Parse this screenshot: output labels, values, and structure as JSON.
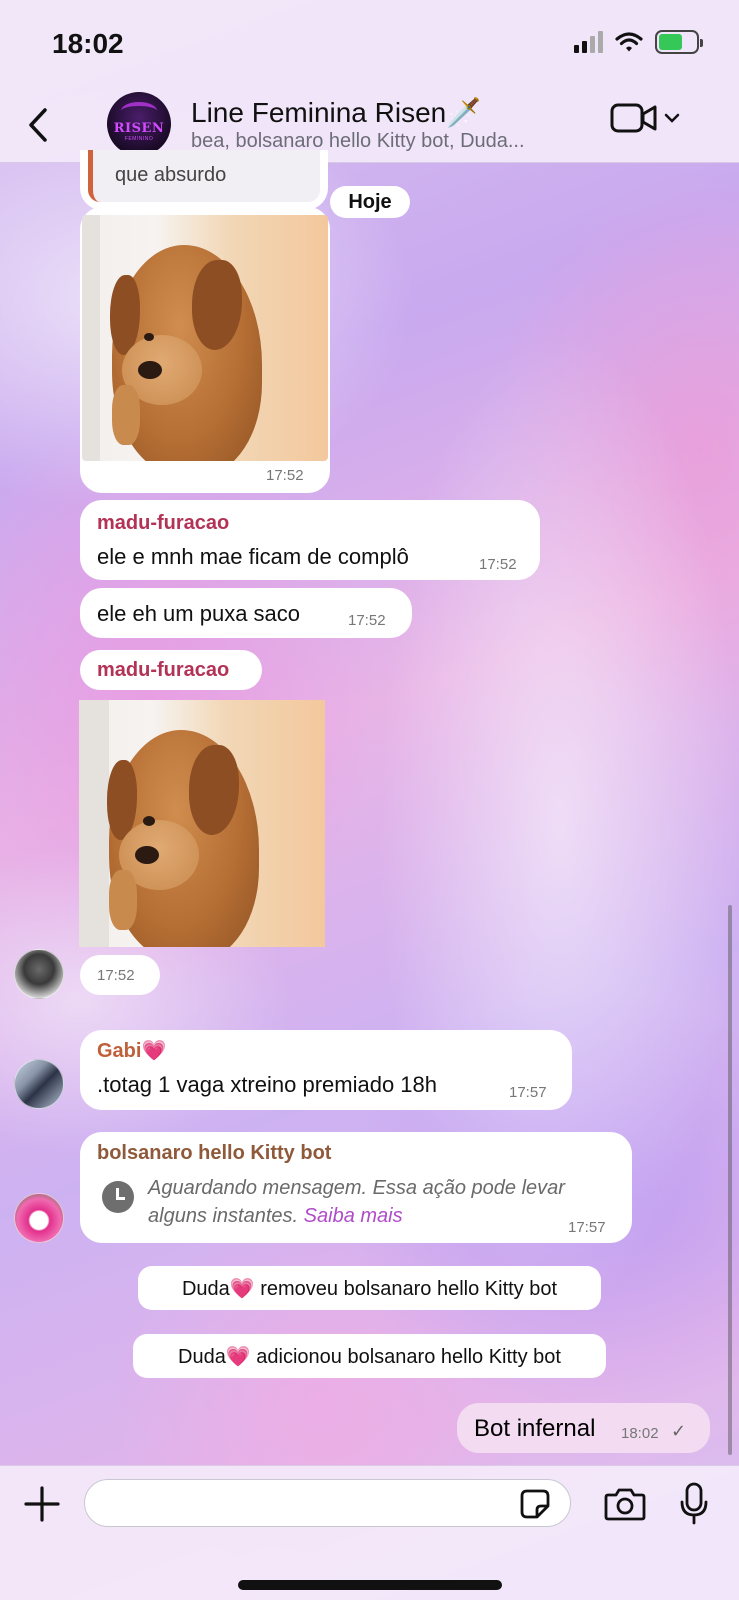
{
  "status_bar": {
    "time": "18:02"
  },
  "header": {
    "title": "Line Feminina Risen🗡️",
    "subtitle": "bea, bolsanaro hello Kitty bot, Duda...",
    "group_avatar_text": "RISEN",
    "group_avatar_subtext": "FEMININO"
  },
  "chat": {
    "quoted_text": "que absurdo",
    "date_pill": "Hoje",
    "image_msg_1_time": "17:52",
    "msg_1": {
      "sender": "madu-furacao",
      "text": "ele e mnh mae ficam de complô",
      "time": "17:52"
    },
    "msg_2": {
      "text": "ele eh um puxa saco",
      "time": "17:52"
    },
    "msg_3": {
      "sender": "madu-furacao",
      "image_time": "17:52"
    },
    "msg_4": {
      "sender": "Gabi💗",
      "text": ".totag 1 vaga xtreino premiado 18h",
      "time": "17:57"
    },
    "msg_5": {
      "sender": "bolsanaro hello Kitty bot",
      "text": "Aguardando mensagem. Essa ação pode levar alguns instantes.",
      "link": "Saiba mais",
      "time": "17:57"
    },
    "system_1": "Duda💗 removeu bolsanaro hello Kitty bot",
    "system_2": "Duda💗 adicionou bolsanaro hello Kitty bot",
    "outgoing": {
      "text": "Bot infernal",
      "time": "18:02",
      "status": "✓"
    }
  },
  "composer": {
    "placeholder": ""
  },
  "colors": {
    "sender_madu": "#b23355",
    "sender_gabi": "#c0603a",
    "sender_bot": "#8e5a3a",
    "link": "#b04bc8",
    "outgoing_bubble": "#f3dcf2"
  }
}
